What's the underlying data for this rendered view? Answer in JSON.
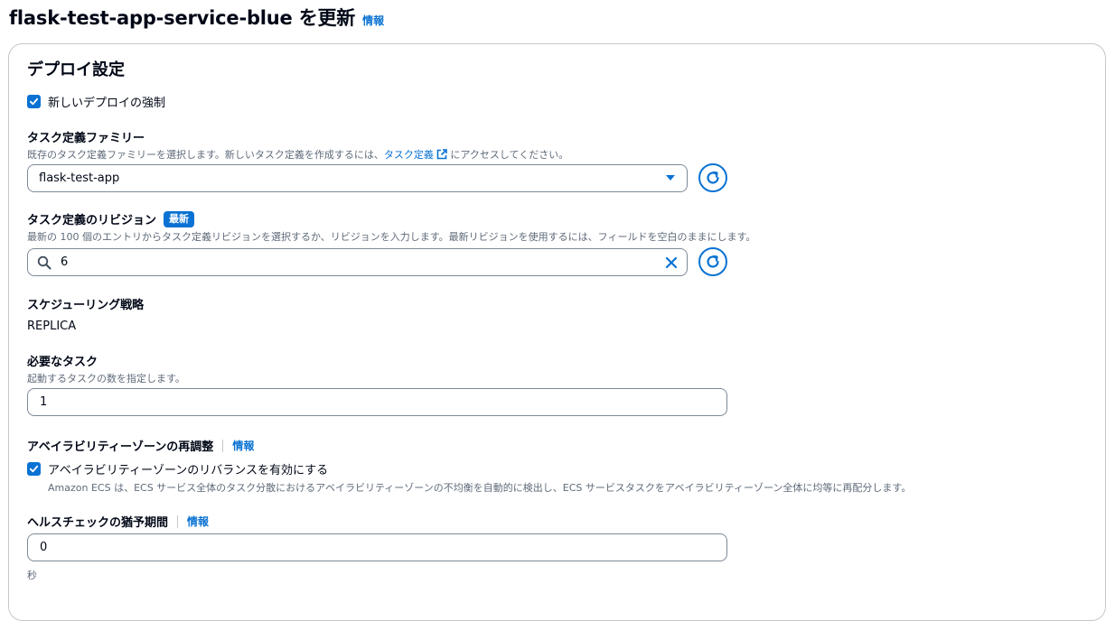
{
  "header": {
    "title": "flask-test-app-service-blue を更新",
    "info": "情報"
  },
  "section": {
    "title": "デプロイ設定"
  },
  "force_deploy": {
    "label": "新しいデプロイの強制",
    "checked": true
  },
  "task_family": {
    "label": "タスク定義ファミリー",
    "desc_before": "既存のタスク定義ファミリーを選択します。新しいタスク定義を作成するには、",
    "desc_link": "タスク定義",
    "desc_after": "にアクセスしてください。",
    "value": "flask-test-app"
  },
  "revision": {
    "label": "タスク定義のリビジョン",
    "badge": "最新",
    "desc": "最新の 100 個のエントリからタスク定義リビジョンを選択するか、リビジョンを入力します。最新リビジョンを使用するには、フィールドを空白のままにします。",
    "value": "6"
  },
  "scheduling": {
    "label": "スケジューリング戦略",
    "value": "REPLICA"
  },
  "desired_tasks": {
    "label": "必要なタスク",
    "desc": "起動するタスクの数を指定します。",
    "value": "1"
  },
  "az_rebalance": {
    "label": "アベイラビリティーゾーンの再調整",
    "info": "情報",
    "checkbox_label": "アベイラビリティーゾーンのリバランスを有効にする",
    "checkbox_desc": "Amazon ECS は、ECS サービス全体のタスク分散におけるアベイラビリティーゾーンの不均衡を自動的に検出し、ECS サービスタスクをアベイラビリティーゾーン全体に均等に再配分します。",
    "checked": true
  },
  "grace_period": {
    "label": "ヘルスチェックの猶予期間",
    "info": "情報",
    "value": "0",
    "unit": "秒"
  },
  "icons": {
    "dropdown": "caret-down-icon",
    "refresh": "refresh-icon",
    "search": "search-icon",
    "clear": "close-icon",
    "external": "external-link-icon",
    "check": "check-icon"
  },
  "colors": {
    "accent": "#0972d3",
    "border": "#7d8998",
    "muted_text": "#5f6b7a"
  }
}
